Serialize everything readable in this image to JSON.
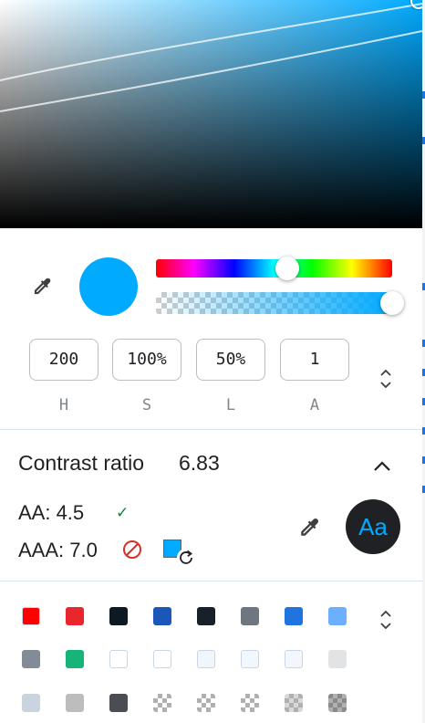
{
  "color": {
    "hex": "#00aaff"
  },
  "hsla": {
    "h": {
      "value": "200",
      "label": "H"
    },
    "s": {
      "value": "100%",
      "label": "S"
    },
    "l": {
      "value": "50%",
      "label": "L"
    },
    "a": {
      "value": "1",
      "label": "A"
    }
  },
  "sliders": {
    "hue_fraction": 0.556,
    "alpha_fraction": 1.0
  },
  "contrast": {
    "title": "Contrast ratio",
    "ratio": "6.83",
    "aa": "AA: 4.5",
    "aa_status": "pass",
    "aaa": "AAA: 7.0",
    "aaa_status": "fail",
    "preview_text": "Aa",
    "preview_bg": "#202124"
  },
  "icons": {
    "eyedropper": "eyedropper-icon",
    "format_toggle": "up-down-chevron-icon",
    "collapse": "chevron-up-icon",
    "pass": "checkmark-icon",
    "fail": "no-entry-icon",
    "refresh": "refresh-icon"
  },
  "palette": {
    "rows": [
      [
        "#ff0000",
        "#e8262b",
        "#0d1a24",
        "#1a57b8",
        "#18202a",
        "#6e7780",
        "#1f74e0",
        "#6ab0ff"
      ],
      [
        "#838c96",
        "#17b47a",
        "#ffffff",
        "#ffffff",
        "#f0f6fb",
        "#f2f7fb",
        "#f3f6fa",
        "#e2e3e4"
      ],
      [
        "#c9d4df",
        "#bdbdbd",
        "#4a4d52",
        "checker-light",
        "checker-light",
        "checker-light",
        "checker-mid",
        "checker-dark"
      ]
    ]
  }
}
